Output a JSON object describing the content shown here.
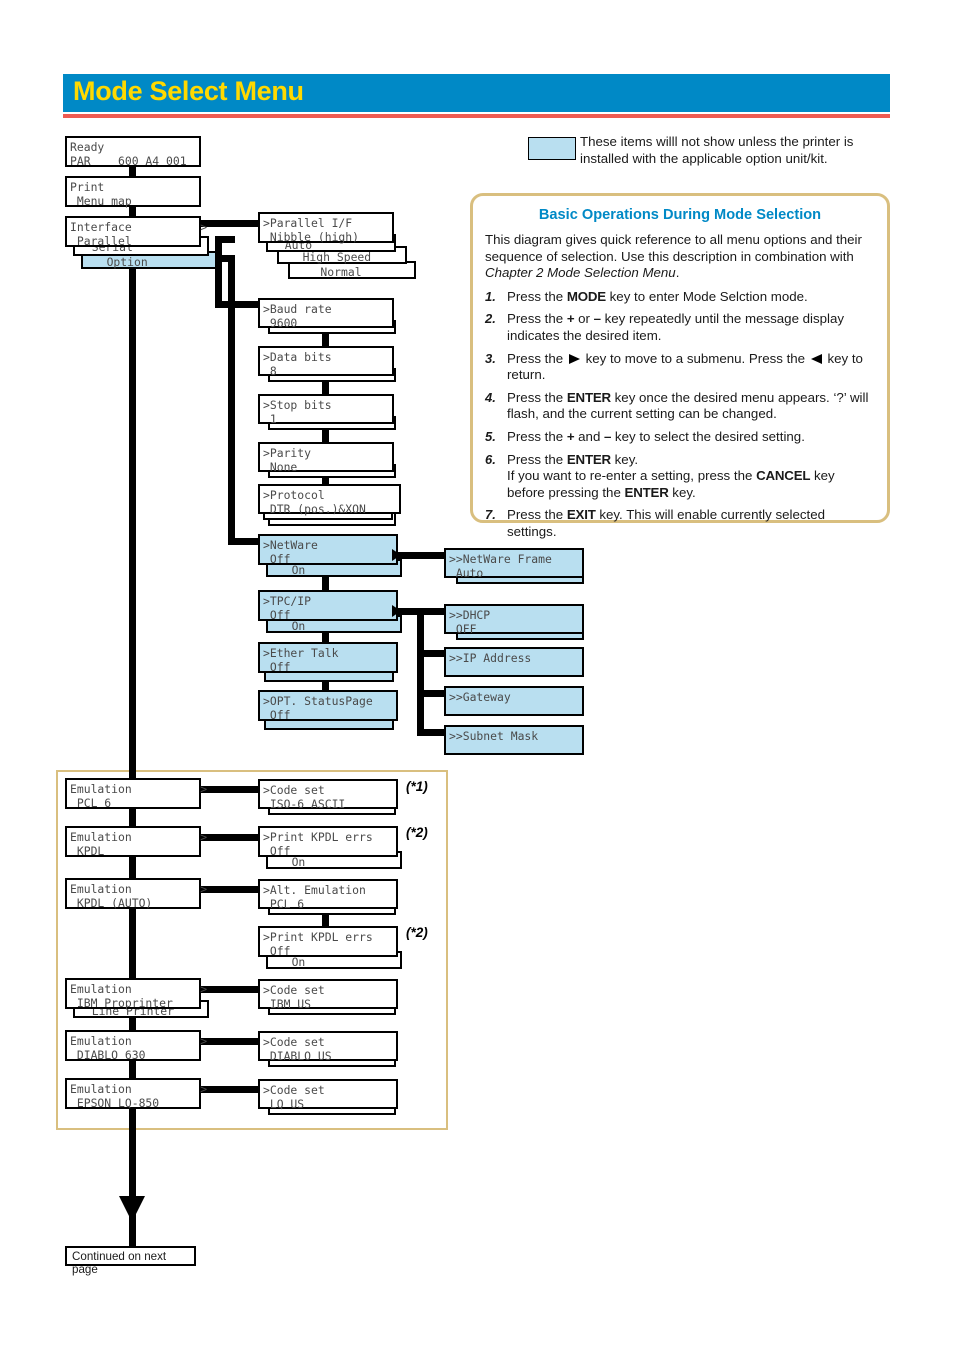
{
  "header": {
    "title": "Mode Select Menu"
  },
  "legend": {
    "note": "These items willl not show unless the printer is installed with the applicable option unit/kit."
  },
  "instructions": {
    "title": "Basic Operations During Mode Selection",
    "intro_a": "This diagram gives quick reference to all menu options and their sequence of selection. Use this description in combination with ",
    "intro_b": "Chapter 2 Mode Selection Menu",
    "intro_c": ".",
    "steps": [
      {
        "num": "1.",
        "a": "Press the ",
        "k1": "MODE",
        "b": " key to enter Mode Selction mode.",
        "k2": "",
        "c": "",
        "k3": "",
        "d": ""
      },
      {
        "num": "2.",
        "a": "Press the ",
        "k1": "+",
        "b": " or ",
        "k2": "–",
        "c": " key repeatedly until the message display indicates the desired item.",
        "k3": "",
        "d": ""
      },
      {
        "num": "3.",
        "a": "Press the ",
        "k1": "",
        "b": " key to move to a submenu. Press the ",
        "k2": "",
        "c": " key to return.",
        "k3": "",
        "d": ""
      },
      {
        "num": "4.",
        "a": "Press the ",
        "k1": "ENTER",
        "b": " key once the desired menu appears. ‘?’ will flash, and the current setting can be changed.",
        "k2": "",
        "c": "",
        "k3": "",
        "d": ""
      },
      {
        "num": "5.",
        "a": "Press the ",
        "k1": "+",
        "b": " and ",
        "k2": "–",
        "c": " key to select the desired setting.",
        "k3": "",
        "d": ""
      },
      {
        "num": "6.",
        "a": "Press the ",
        "k1": "ENTER",
        "b": " key.",
        "k2": "",
        "c": "",
        "k3": "",
        "d": ""
      },
      {
        "num": "7.",
        "a": "Press the ",
        "k1": "EXIT",
        "b": " key. This will enable currently selected settings.",
        "k2": "",
        "c": "",
        "k3": "",
        "d": ""
      }
    ],
    "step6_line2_a": "If you want to re-enter a setting, press the ",
    "step6_line2_k": "CANCEL",
    "step6_line2_b": " key before pressing the ",
    "step6_line2_k2": "ENTER",
    "step6_line2_c": " key."
  },
  "colors": {
    "header_bar": "#0089c6",
    "header_text": "#ffd900",
    "header_rule": "#ee5b52",
    "option_highlight": "#b9dff0",
    "panel_border": "#d9bf7f",
    "accent_title": "#0089c6"
  },
  "menu": {
    "status": {
      "line1": "Ready",
      "line2": "PAR    600 A4 001"
    },
    "print": {
      "line1": "Print",
      "line2": " Menu map"
    },
    "interface": {
      "line1": "Interface          >",
      "line2": " Parallel",
      "opt_serial": "  Serial",
      "opt_option": "   Option"
    },
    "parallel_if": {
      "line1": ">Parallel I/F",
      "line2": " Nibble (high)",
      "opt_auto": "  Auto",
      "opt_high": "   High Speed",
      "opt_normal": "    Normal"
    },
    "serial": [
      {
        "line1": ">Baud rate",
        "line2": " 9600"
      },
      {
        "line1": ">Data bits",
        "line2": " 8"
      },
      {
        "line1": ">Stop bits",
        "line2": " 1"
      },
      {
        "line1": ">Parity",
        "line2": " None"
      },
      {
        "line1": ">Protocol",
        "line2": " DTR (pos.)&XON"
      }
    ],
    "network": {
      "netware": {
        "line1": ">NetWare",
        "line2": " Off",
        "opt": "   On"
      },
      "netware_frame": {
        "line1": ">>NetWare Frame",
        "line2": " Auto"
      },
      "tcpip": {
        "line1": ">TPC/IP",
        "line2": " Off",
        "opt": "   On"
      },
      "dhcp": {
        "line1": ">>DHCP",
        "line2": " OFF"
      },
      "ip_address": {
        "line1": ">>IP Address",
        "line2": ""
      },
      "gateway": {
        "line1": ">>Gateway",
        "line2": ""
      },
      "subnet_mask": {
        "line1": ">>Subnet Mask",
        "line2": ""
      },
      "ether_talk": {
        "line1": ">Ether Talk",
        "line2": " Off"
      },
      "opt_statuspage": {
        "line1": ">OPT. StatusPage",
        "line2": " Off"
      }
    },
    "emulation": [
      {
        "line1": "Emulation          >",
        "line2": " PCL 6",
        "extra": ""
      },
      {
        "line1": "Emulation          >",
        "line2": " KPDL",
        "extra": ""
      },
      {
        "line1": "Emulation          >",
        "line2": " KPDL (AUTO)",
        "extra": ""
      },
      {
        "line1": "Emulation          >",
        "line2": " IBM Proprinter",
        "extra": "  Line Printer"
      },
      {
        "line1": "Emulation          >",
        "line2": " DIABLO 630",
        "extra": ""
      },
      {
        "line1": "Emulation          >",
        "line2": " EPSON LQ-850",
        "extra": ""
      }
    ],
    "emulation_sub": {
      "code_set_pcl": {
        "line1": ">Code set",
        "line2": " ISO-6 ASCII"
      },
      "print_kpdl_errs_1": {
        "line1": ">Print KPDL errs",
        "line2": " Off",
        "opt": "   On"
      },
      "alt_emulation": {
        "line1": ">Alt. Emulation",
        "line2": " PCL 6"
      },
      "print_kpdl_errs_2": {
        "line1": ">Print KPDL errs",
        "line2": " Off",
        "opt": "   On"
      },
      "code_set_ibm": {
        "line1": ">Code set",
        "line2": " IBM US"
      },
      "code_set_diablo": {
        "line1": ">Code set",
        "line2": " DIABLO US"
      },
      "code_set_lq": {
        "line1": ">Code set",
        "line2": " LQ US"
      }
    },
    "notes": {
      "n1": "(*1)",
      "n2a": "(*2)",
      "n2b": "(*2)"
    },
    "continued": "Continued on next page"
  }
}
